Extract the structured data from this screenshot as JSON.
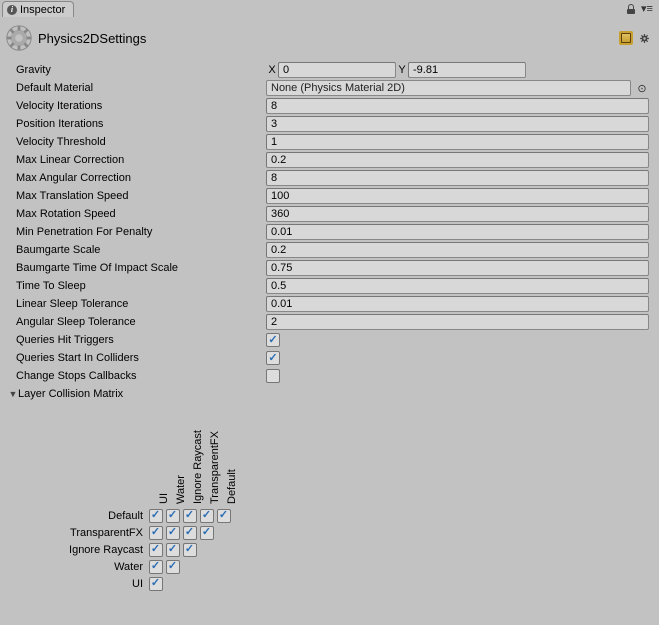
{
  "tab": {
    "label": "Inspector"
  },
  "title": "Physics2DSettings",
  "gravity": {
    "label": "Gravity",
    "xlabel": "X",
    "x": "0",
    "ylabel": "Y",
    "y": "-9.81"
  },
  "defaultMaterial": {
    "label": "Default Material",
    "value": "None (Physics Material 2D)"
  },
  "fields": [
    {
      "label": "Velocity Iterations",
      "value": "8"
    },
    {
      "label": "Position Iterations",
      "value": "3"
    },
    {
      "label": "Velocity Threshold",
      "value": "1"
    },
    {
      "label": "Max Linear Correction",
      "value": "0.2"
    },
    {
      "label": "Max Angular Correction",
      "value": "8"
    },
    {
      "label": "Max Translation Speed",
      "value": "100"
    },
    {
      "label": "Max Rotation Speed",
      "value": "360"
    },
    {
      "label": "Min Penetration For Penalty",
      "value": "0.01"
    },
    {
      "label": "Baumgarte Scale",
      "value": "0.2"
    },
    {
      "label": "Baumgarte Time Of Impact Scale",
      "value": "0.75"
    },
    {
      "label": "Time To Sleep",
      "value": "0.5"
    },
    {
      "label": "Linear Sleep Tolerance",
      "value": "0.01"
    },
    {
      "label": "Angular Sleep Tolerance",
      "value": "2"
    }
  ],
  "checks": [
    {
      "label": "Queries Hit Triggers",
      "on": true
    },
    {
      "label": "Queries Start In Colliders",
      "on": true
    },
    {
      "label": "Change Stops Callbacks",
      "on": false
    }
  ],
  "matrix": {
    "label": "Layer Collision Matrix",
    "cols": [
      "Default",
      "TransparentFX",
      "Ignore Raycast",
      "Water",
      "UI"
    ],
    "rows": [
      {
        "label": "Default",
        "cells": [
          true,
          true,
          true,
          true,
          true
        ]
      },
      {
        "label": "TransparentFX",
        "cells": [
          true,
          true,
          true,
          true
        ]
      },
      {
        "label": "Ignore Raycast",
        "cells": [
          true,
          true,
          true
        ]
      },
      {
        "label": "Water",
        "cells": [
          true,
          true
        ]
      },
      {
        "label": "UI",
        "cells": [
          true
        ]
      }
    ]
  }
}
